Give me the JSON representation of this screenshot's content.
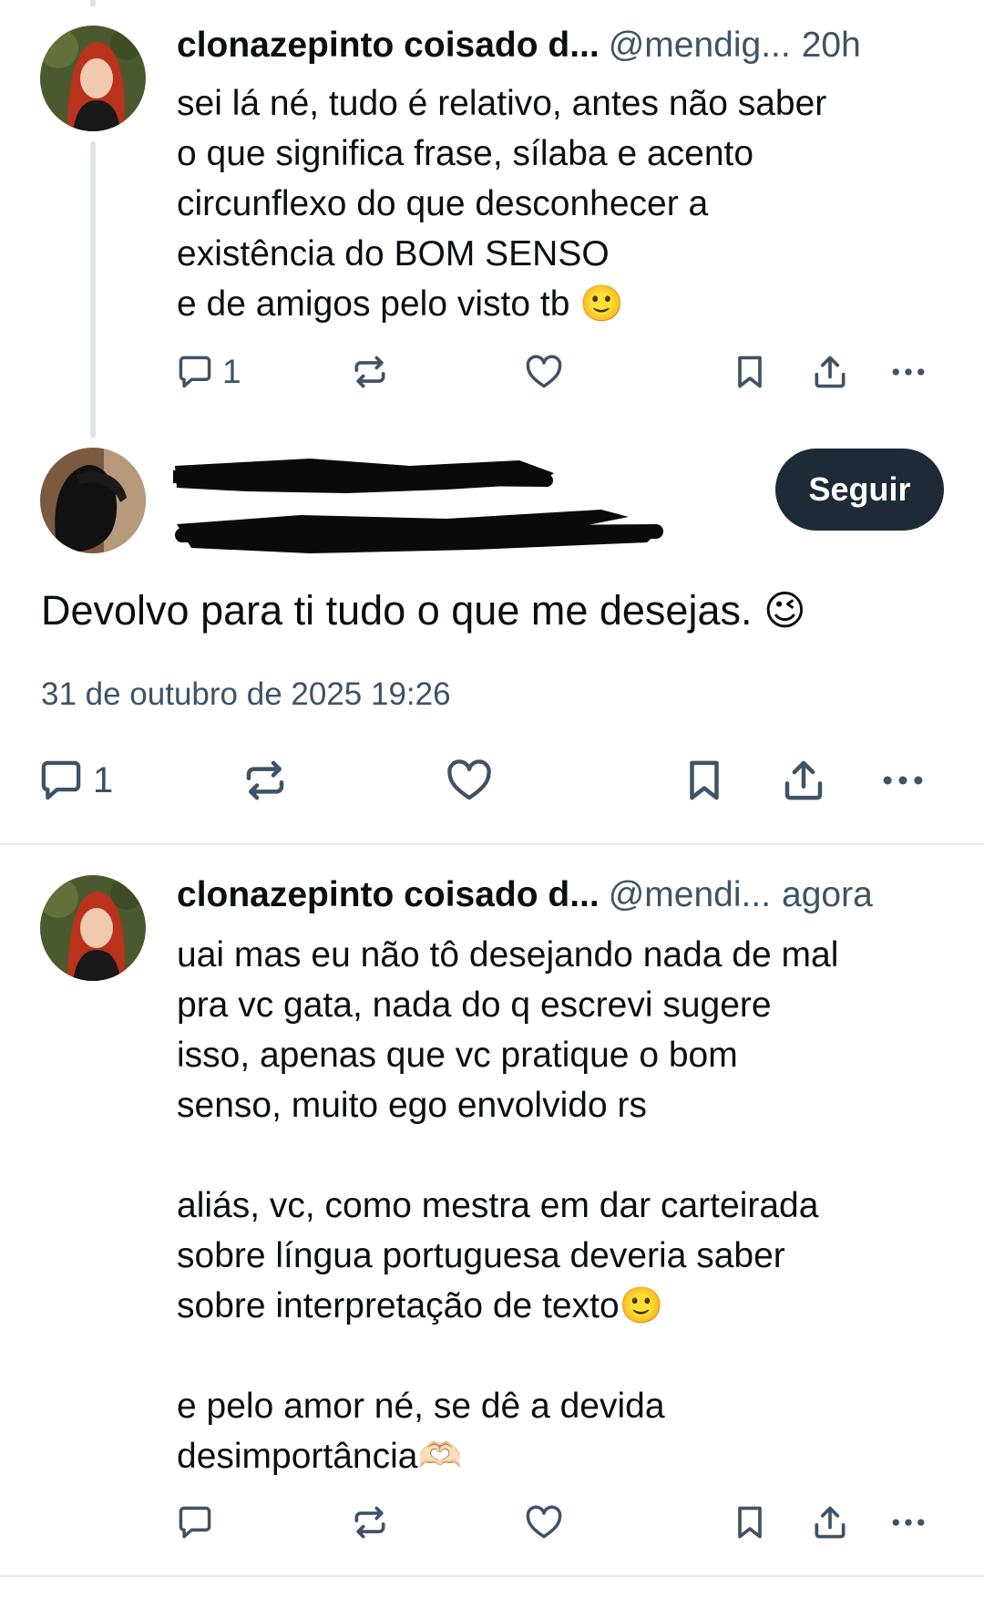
{
  "colors": {
    "text_primary": "#0b0f14",
    "text_secondary": "#3f5266",
    "follow_button_bg": "#1f2a38",
    "follow_button_text": "#ffffff",
    "thread_line": "#dfe3e8",
    "divider": "#e6e9ed"
  },
  "parent_reply": {
    "author_name": "clonazepinto coisado d...",
    "author_handle": "@mendig...",
    "time": "20h",
    "text": "sei lá né, tudo é relativo, antes não saber\no que significa frase, sílaba e acento\ncircunflexo do que desconhecer a\nexistência do BOM SENSO\ne de amigos pelo visto tb 🙂",
    "actions": {
      "reply_count": "1",
      "repost_count": "",
      "like_count": "",
      "icons": [
        "reply-icon",
        "repost-icon",
        "heart-icon",
        "bookmark-icon",
        "share-icon",
        "more-icon"
      ]
    }
  },
  "main_post": {
    "author_name_redacted": true,
    "author_handle_redacted": true,
    "follow_label": "Seguir",
    "text": "Devolvo para ti tudo o que me desejas. 😉",
    "timestamp": "31 de outubro de 2025 19:26",
    "actions": {
      "reply_count": "1",
      "repost_count": "",
      "like_count": "",
      "icons": [
        "reply-icon",
        "repost-icon",
        "heart-icon",
        "bookmark-icon",
        "share-icon",
        "more-icon"
      ]
    }
  },
  "child_reply": {
    "author_name": "clonazepinto coisado d...",
    "author_handle": "@mendi...",
    "time": "agora",
    "text": "uai mas eu não tô desejando nada de mal\npra vc gata, nada do q escrevi sugere\nisso, apenas que vc pratique o bom\nsenso, muito ego envolvido rs\n\naliás, vc, como mestra em dar carteirada\nsobre língua portuguesa deveria saber\nsobre interpretação de texto🙂\n\ne pelo amor né, se dê a devida\ndesimportância🫶🏻",
    "actions": {
      "reply_count": "",
      "repost_count": "",
      "like_count": "",
      "icons": [
        "reply-icon",
        "repost-icon",
        "heart-icon",
        "bookmark-icon",
        "share-icon",
        "more-icon"
      ]
    }
  }
}
